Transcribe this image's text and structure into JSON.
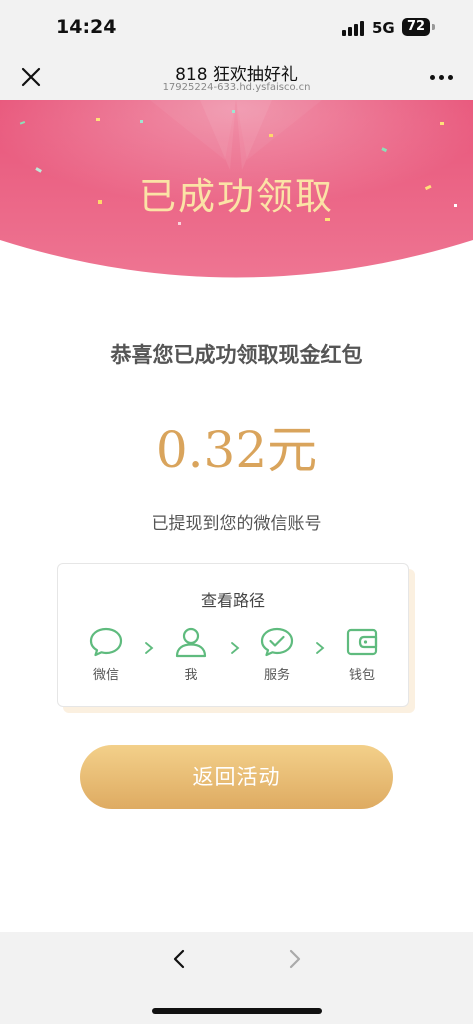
{
  "status_bar": {
    "time": "14:24",
    "network": "5G",
    "battery": "72"
  },
  "nav": {
    "title": "818 狂欢抽好礼",
    "url": "17925224-633.hd.ysfaisco.cn"
  },
  "banner": {
    "title": "已成功领取"
  },
  "content": {
    "congrats": "恭喜您已成功领取现金红包",
    "amount": "0.32元",
    "note": "已提现到您的微信账号"
  },
  "path_card": {
    "title": "查看路径",
    "steps": [
      {
        "label": "微信",
        "icon": "chat-bubble-icon"
      },
      {
        "label": "我",
        "icon": "user-icon"
      },
      {
        "label": "服务",
        "icon": "check-bubble-icon"
      },
      {
        "label": "钱包",
        "icon": "wallet-icon"
      }
    ]
  },
  "button": {
    "label": "返回活动"
  },
  "colors": {
    "banner": "#e86a88",
    "accent": "#d9a45c",
    "wechat_green": "#5fbb7e",
    "button": "#e9bd73"
  }
}
